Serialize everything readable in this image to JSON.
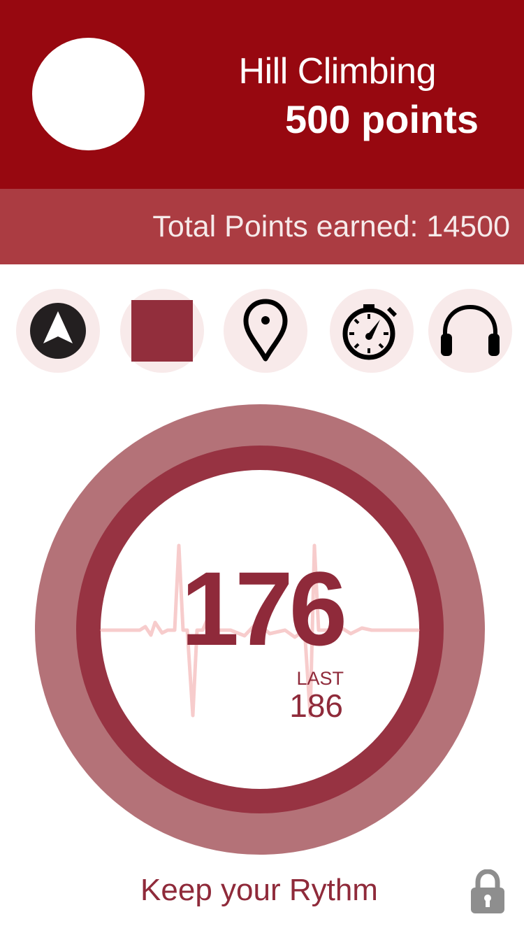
{
  "header": {
    "activity_name": "Hill Climbing",
    "activity_points": "500 points",
    "background_color": "#970810"
  },
  "summary": {
    "total_points_text": "Total Points earned: 14500",
    "background_color": "#ab3c42"
  },
  "toolbar": {
    "items": [
      {
        "icon": "navigation-arrow-icon"
      },
      {
        "icon": "stop-icon"
      },
      {
        "icon": "location-pin-icon"
      },
      {
        "icon": "stopwatch-icon"
      },
      {
        "icon": "headphones-icon"
      }
    ]
  },
  "heart_rate": {
    "current": "176",
    "last_label": "LAST",
    "last_value": "186"
  },
  "footer": {
    "message": "Keep your Rythm",
    "lock_icon": "lock-icon"
  },
  "colors": {
    "accent": "#8f2a3a",
    "ring_outer": "#b47278",
    "ring_inner": "#973342",
    "ecg_line": "#f7cccc",
    "tool_bg": "#f8eaea"
  }
}
